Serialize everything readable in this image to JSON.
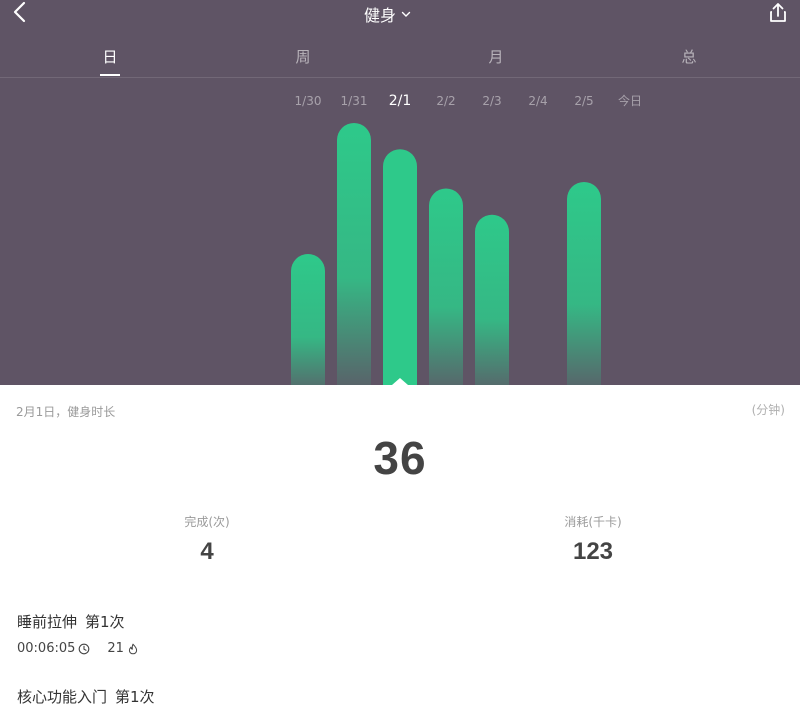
{
  "nav": {
    "title": "健身",
    "back_icon": "chevron-left-icon",
    "dropdown_icon": "chevron-down-icon",
    "share_icon": "share-icon"
  },
  "tabs": [
    {
      "label": "日",
      "active": true
    },
    {
      "label": "周",
      "active": false
    },
    {
      "label": "月",
      "active": false
    },
    {
      "label": "总",
      "active": false
    }
  ],
  "colors": {
    "header_bg": "#5f5465",
    "bar_green": "#2ec98a",
    "text_dark": "#444444",
    "text_muted": "#9a9a9a"
  },
  "chart_data": {
    "type": "bar",
    "categories": [
      "1/30",
      "1/31",
      "2/1",
      "2/2",
      "2/3",
      "2/4",
      "2/5",
      "今日"
    ],
    "values": [
      20,
      40,
      36,
      30,
      26,
      0,
      31,
      0
    ],
    "selected": "2/1",
    "grid": false
  },
  "summary": {
    "date_label": "2月1日，健身时长",
    "unit_label": "(分钟)",
    "duration_value": "36"
  },
  "stats": {
    "completed": {
      "label": "完成(次)",
      "value": "4"
    },
    "calories": {
      "label": "消耗(千卡)",
      "value": "123"
    }
  },
  "workouts": [
    {
      "name": "睡前拉伸",
      "count": "第1次",
      "time": "00:06:05",
      "time_icon": "clock-icon",
      "calories": "21",
      "calories_icon": "flame-icon"
    },
    {
      "name": "核心功能入门",
      "count": "第1次"
    }
  ]
}
